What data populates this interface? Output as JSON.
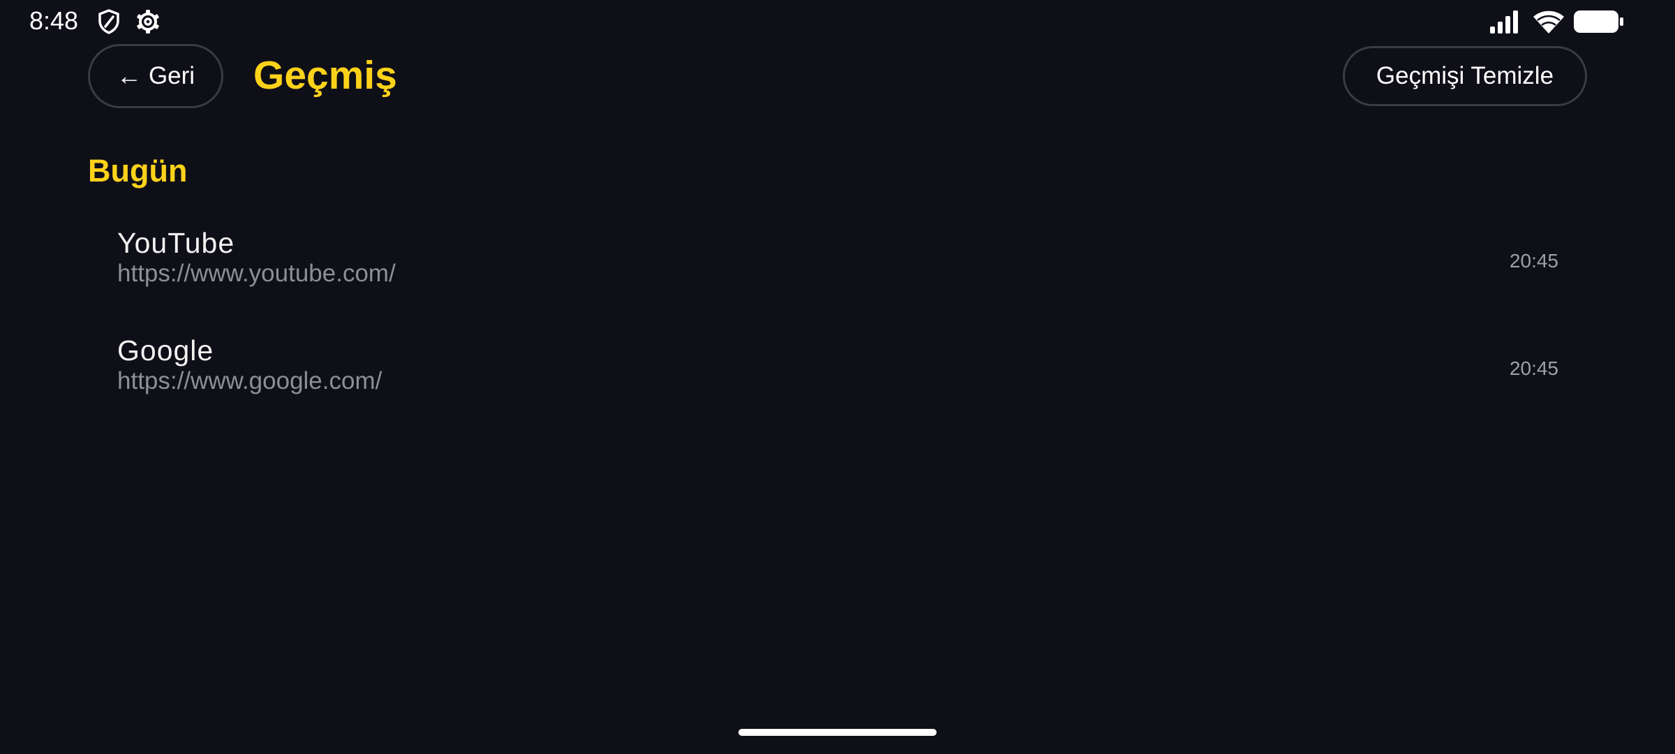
{
  "status_bar": {
    "time": "8:48",
    "left_icons": [
      "shield-icon",
      "gear-icon"
    ],
    "right_icons": [
      "signal-icon",
      "wifi-icon",
      "battery-icon"
    ]
  },
  "header": {
    "back_arrow": "←",
    "back_label": "Geri",
    "title": "Geçmiş",
    "clear_label": "Geçmişi Temizle"
  },
  "sections": [
    {
      "title": "Bugün",
      "items": [
        {
          "title": "YouTube",
          "url": "https://www.youtube.com/",
          "time": "20:45"
        },
        {
          "title": "Google",
          "url": "https://www.google.com/",
          "time": "20:45"
        }
      ]
    }
  ],
  "colors": {
    "background": "#0f0f18",
    "accent": "#ffd21a",
    "button_border": "#3b3b45",
    "secondary_text": "#8e8e96"
  }
}
